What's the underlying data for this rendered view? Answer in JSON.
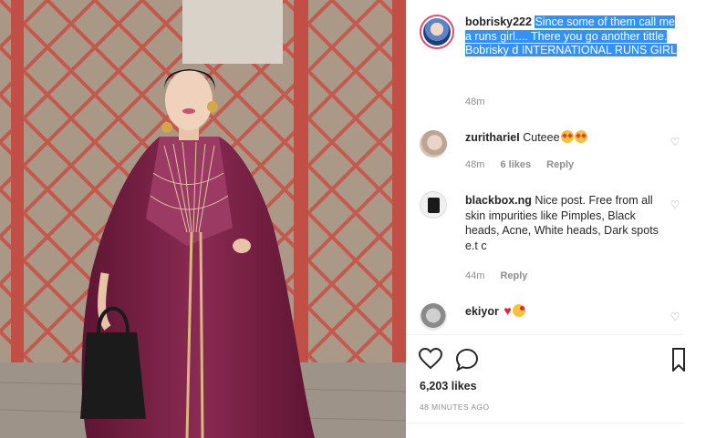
{
  "post": {
    "author": "bobrisky222",
    "caption": "Since some of them call me a runs girl.... There you go another tittle. Bobrisky d INTERNATIONAL RUNS GIRL",
    "caption_time": "48m",
    "likes": "6,203 likes",
    "posted_ago": "48 MINUTES AGO"
  },
  "comments": [
    {
      "user": "zuritharieI",
      "text": "Cuteee",
      "emojis": [
        "star-struck-emoji",
        "star-struck-emoji"
      ],
      "time": "48m",
      "likes": "6 likes",
      "reply": "Reply"
    },
    {
      "user": "blackbox.ng",
      "text": "Nice post. Free from all skin impurities like Pimples, Black heads, Acne, White heads, Dark spots e.t c",
      "time": "44m",
      "reply": "Reply"
    },
    {
      "user": "ekiyor",
      "text": "",
      "emojis": [
        "red-heart-emoji",
        "kissing-face-emoji"
      ]
    }
  ],
  "icons": {
    "like": "heart-outline-icon",
    "comment": "comment-bubble-icon",
    "save": "bookmark-icon",
    "comment_like": "small-heart-icon"
  },
  "colors": {
    "highlight": "#3390ff",
    "story_ring": "#e9486b",
    "dress": "#7a1f43",
    "wall_frame": "#c8584d"
  }
}
